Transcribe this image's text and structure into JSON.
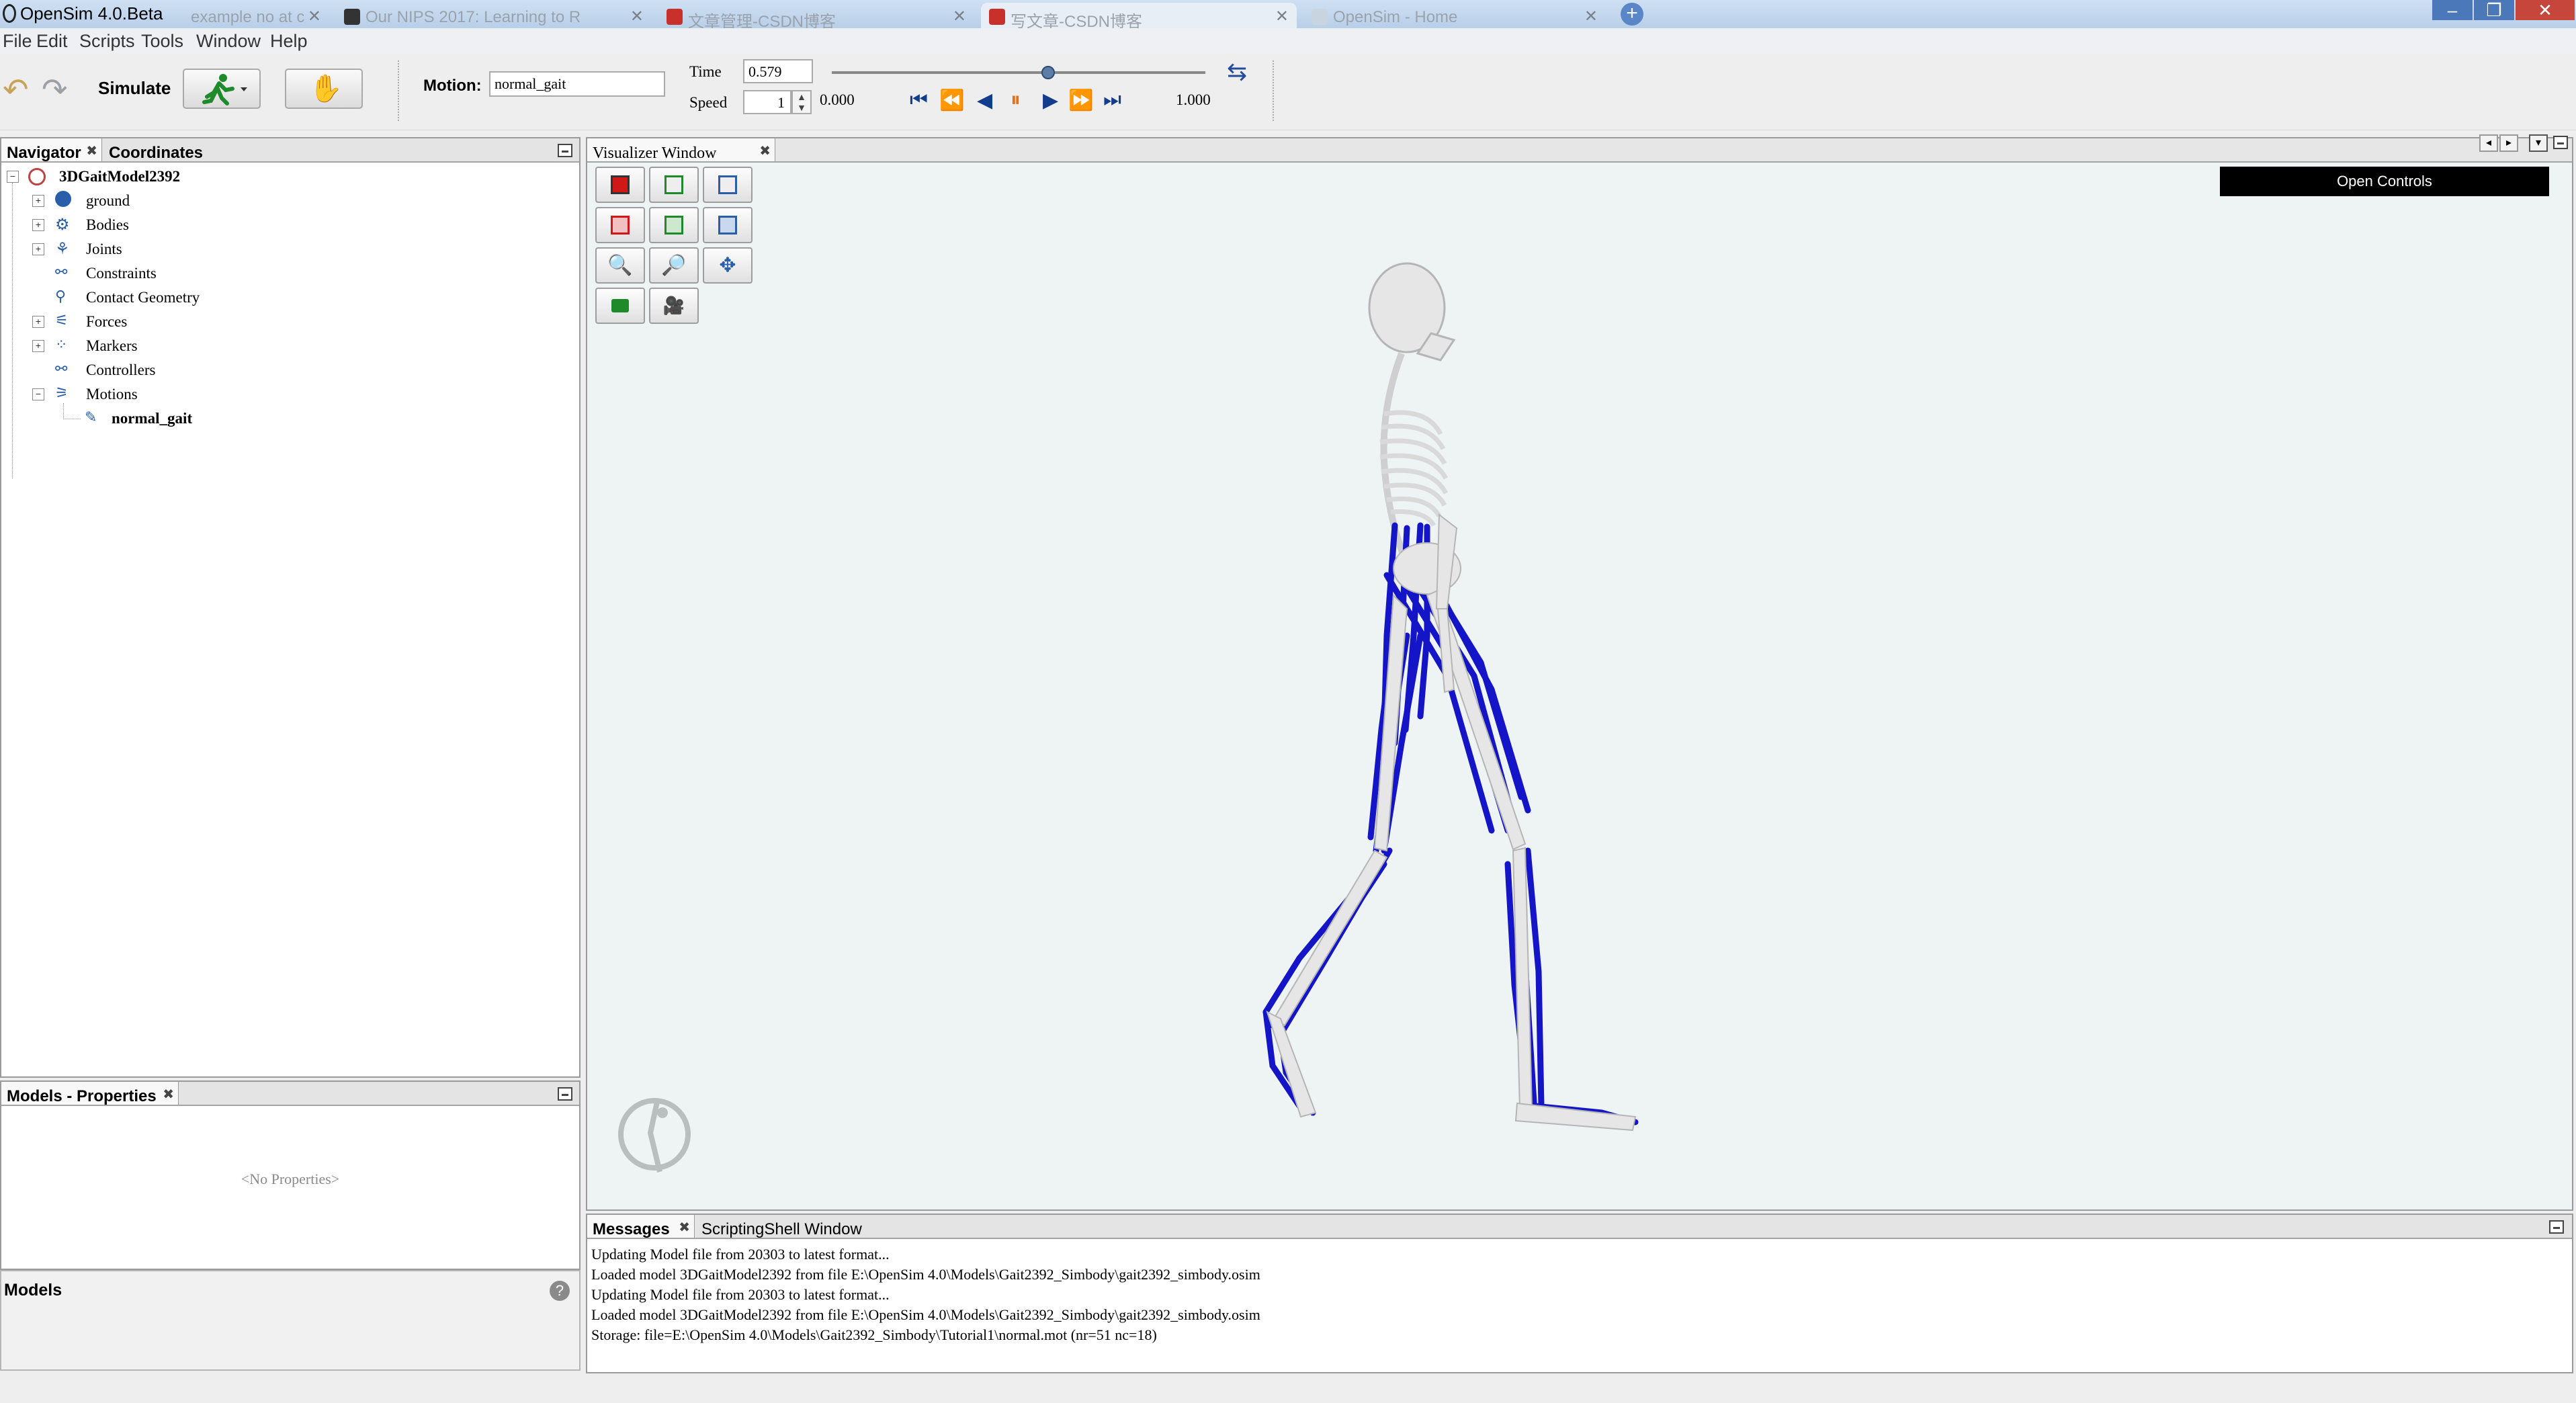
{
  "window": {
    "title": "OpenSim 4.0.Beta"
  },
  "browser_tabs": [
    {
      "label": "example no at c"
    },
    {
      "label": "Our NIPS 2017: Learning to R"
    },
    {
      "label": "文章管理-CSDN博客"
    },
    {
      "label": "写文章-CSDN博客"
    },
    {
      "label": "OpenSim - Home"
    }
  ],
  "window_controls": {
    "minimize": "–",
    "restore": "❐",
    "close": "✕"
  },
  "menu": [
    "File",
    "Edit",
    "Scripts",
    "Tools",
    "Window",
    "Help"
  ],
  "toolbar": {
    "simulate_label": "Simulate",
    "motion_label": "Motion:",
    "motion_value": "normal_gait",
    "time_label": "Time",
    "time_value": "0.579",
    "speed_label": "Speed",
    "speed_value": "1",
    "range_start": "0.000",
    "range_end": "1.000",
    "slider_fraction": 0.579
  },
  "navigator": {
    "tab_label": "Navigator",
    "second_tab_label": "Coordinates",
    "model_name": "3DGaitModel2392",
    "items": [
      {
        "label": "ground",
        "icon": "ground-icon"
      },
      {
        "label": "Bodies",
        "icon": "bodies-icon"
      },
      {
        "label": "Joints",
        "icon": "joints-icon"
      },
      {
        "label": "Constraints",
        "icon": "constraints-icon"
      },
      {
        "label": "Contact Geometry",
        "icon": "contact-geometry-icon"
      },
      {
        "label": "Forces",
        "icon": "forces-icon"
      },
      {
        "label": "Markers",
        "icon": "markers-icon"
      },
      {
        "label": "Controllers",
        "icon": "controllers-icon"
      },
      {
        "label": "Motions",
        "icon": "motions-icon"
      }
    ],
    "motion_child": "normal_gait"
  },
  "properties": {
    "tab_label": "Models - Properties",
    "empty_text": "<No Properties>"
  },
  "models_panel": {
    "title": "Models",
    "help_glyph": "?"
  },
  "visualizer": {
    "tab_label": "Visualizer Window",
    "open_controls_label": "Open Controls"
  },
  "messages": {
    "tab_label": "Messages",
    "second_tab_label": "ScriptingShell Window",
    "lines": [
      "Updating Model file from 20303 to latest format...",
      "Loaded model 3DGaitModel2392 from file E:\\OpenSim 4.0\\Models\\Gait2392_Simbody\\gait2392_simbody.osim",
      "Updating Model file from 20303 to latest format...",
      "Loaded model 3DGaitModel2392 from file E:\\OpenSim 4.0\\Models\\Gait2392_Simbody\\gait2392_simbody.osim",
      "Storage: file=E:\\OpenSim 4.0\\Models\\Gait2392_Simbody\\Tutorial1\\normal.mot (nr=51 nc=18)"
    ]
  },
  "colors": {
    "muscle": "#1515c8",
    "bone": "#e6e6e6",
    "viewport_bg": "#eef3f3",
    "open_controls_bg": "#000000"
  }
}
